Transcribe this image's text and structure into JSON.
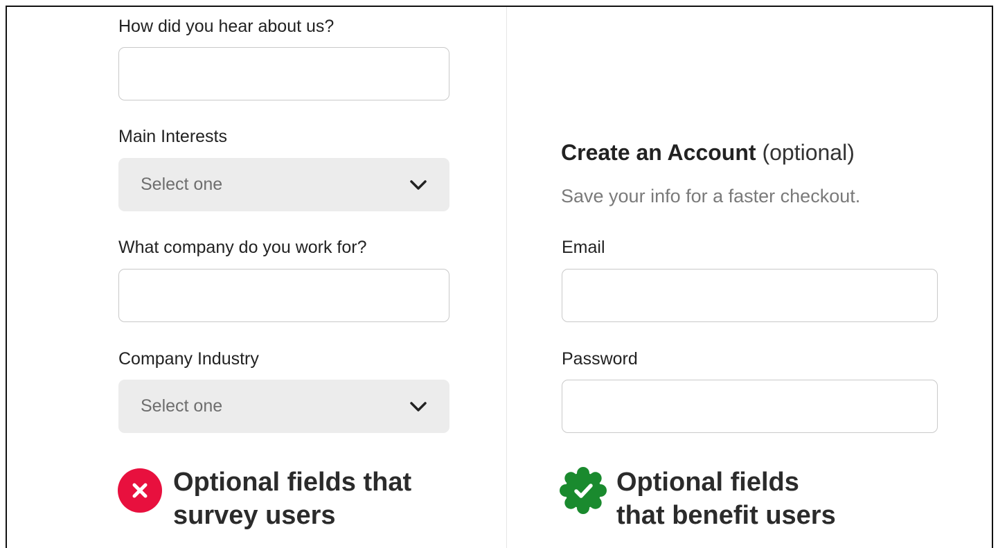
{
  "left_form": {
    "hear_label": "How did you hear about us?",
    "hear_value": "",
    "interests_label": "Main Interests",
    "interests_value": "Select one",
    "company_label": "What company do you work for?",
    "company_value": "",
    "industry_label": "Company Industry",
    "industry_value": "Select one"
  },
  "right_form": {
    "title": "Create an Account",
    "title_suffix": "(optional)",
    "subtitle": "Save your info for a faster checkout.",
    "email_label": "Email",
    "email_value": "",
    "password_label": "Password",
    "password_value": ""
  },
  "verdicts": {
    "bad_line1": "Optional fields that",
    "bad_line2": "survey users",
    "good_line1": "Optional fields",
    "good_line2": "that benefit users"
  },
  "icons": {
    "bad": "x-circle-icon",
    "good": "check-badge-icon",
    "dropdown": "chevron-down-icon"
  },
  "colors": {
    "bad": "#e8103e",
    "good": "#1a8a2e",
    "select_bg": "#ececec"
  }
}
